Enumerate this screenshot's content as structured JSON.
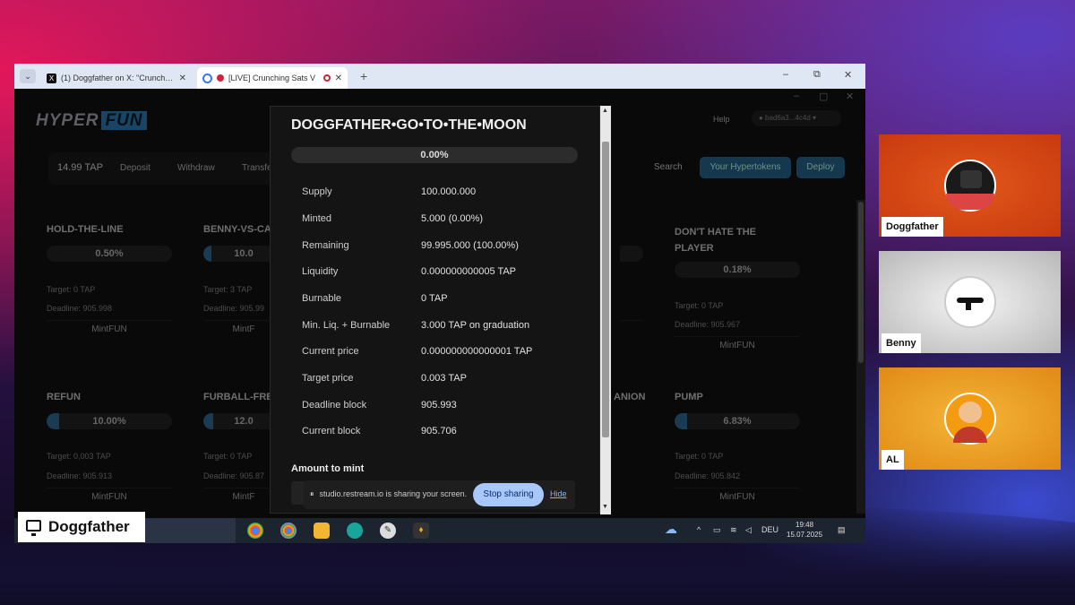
{
  "browser": {
    "tabs": [
      {
        "title": "(1) Doggfather on X: \"Crunching",
        "favicon": "X"
      },
      {
        "title": "[LIVE] Crunching Sats V",
        "favicon": "rec"
      }
    ],
    "new_tab": "+",
    "window_controls": {
      "minimize": "–",
      "restore": "⧉",
      "close": "✕"
    }
  },
  "app": {
    "logo": {
      "part1": "HYPER",
      "part2": "FUN"
    },
    "help": "Help",
    "wallet": "● bad6a3...4c4d ▾",
    "balance": "14.99 TAP",
    "balance_actions": [
      "Deposit",
      "Withdraw",
      "Transfer"
    ],
    "search": "Search",
    "your_hypertokens": "Your Hypertokens",
    "deploy": "Deploy",
    "cards": [
      {
        "title": "HOLD-THE-LINE",
        "progress": "0.50%",
        "target": "Target: 0 TAP",
        "deadline": "Deadline: 905.998",
        "mint": "MintFUN"
      },
      {
        "title": "BENNY-VS-CA",
        "progress": "10.0",
        "target": "Target: 3 TAP",
        "deadline": "Deadline: 905.99",
        "mint": "MintF"
      },
      {
        "title": "DON'T HATE THE PLAYER",
        "progress": "0.18%",
        "target": "Target: 0 TAP",
        "deadline": "Deadline: 905.967",
        "mint": "MintFUN"
      },
      {
        "title": "REFUN",
        "progress": "10.00%",
        "target": "Target: 0,003 TAP",
        "deadline": "Deadline: 905.913",
        "mint": "MintFUN"
      },
      {
        "title": "FURBALL-FRE",
        "progress": "12.0",
        "target": "Target: 0 TAP",
        "deadline": "Deadline: 905.87",
        "mint": "MintF"
      },
      {
        "title": "ANION",
        "progress": "",
        "target": "",
        "deadline": "",
        "mint": ""
      },
      {
        "title": "PUMP",
        "progress": "6.83%",
        "target": "Target: 0 TAP",
        "deadline": "Deadline: 905.842",
        "mint": "MintFUN"
      }
    ],
    "progress_fill": {
      "refun": 0.1,
      "pump": 0.068,
      "benny": 0.1,
      "furball": 0.12
    },
    "accent_color": "#2e6c9a"
  },
  "modal": {
    "title": "DOGGFATHER•GO•TO•THE•MOON",
    "progress": "0.00%",
    "rows": [
      {
        "label": "Supply",
        "value": "100.000.000"
      },
      {
        "label": "Minted",
        "value": "5.000 (0.00%)"
      },
      {
        "label": "Remaining",
        "value": "99.995.000 (100.00%)"
      },
      {
        "label": "Liquidity",
        "value": "0.000000000005 TAP"
      },
      {
        "label": "Burnable",
        "value": "0 TAP"
      },
      {
        "label": "Min. Liq. + Burnable",
        "value": "3.000 TAP on graduation"
      },
      {
        "label": "Current price",
        "value": "0.000000000000001 TAP"
      },
      {
        "label": "Target price",
        "value": "0.003 TAP"
      },
      {
        "label": "Deadline block",
        "value": "905.993"
      },
      {
        "label": "Current block",
        "value": "905.706"
      }
    ],
    "amount_label": "Amount to mint"
  },
  "share_bar": {
    "text": "studio.restream.io is sharing your screen.",
    "stop": "Stop sharing",
    "hide": "Hide"
  },
  "taskbar": {
    "language": "DEU",
    "time": "19:48",
    "date": "15.07.2025"
  },
  "presenter": {
    "name": "Doggfather"
  },
  "participants": [
    {
      "name": "Doggfather",
      "bg": "#e85a1a"
    },
    {
      "name": "Benny",
      "bg": "#d9d9d9"
    },
    {
      "name": "AL",
      "bg": "#f0a020"
    }
  ]
}
